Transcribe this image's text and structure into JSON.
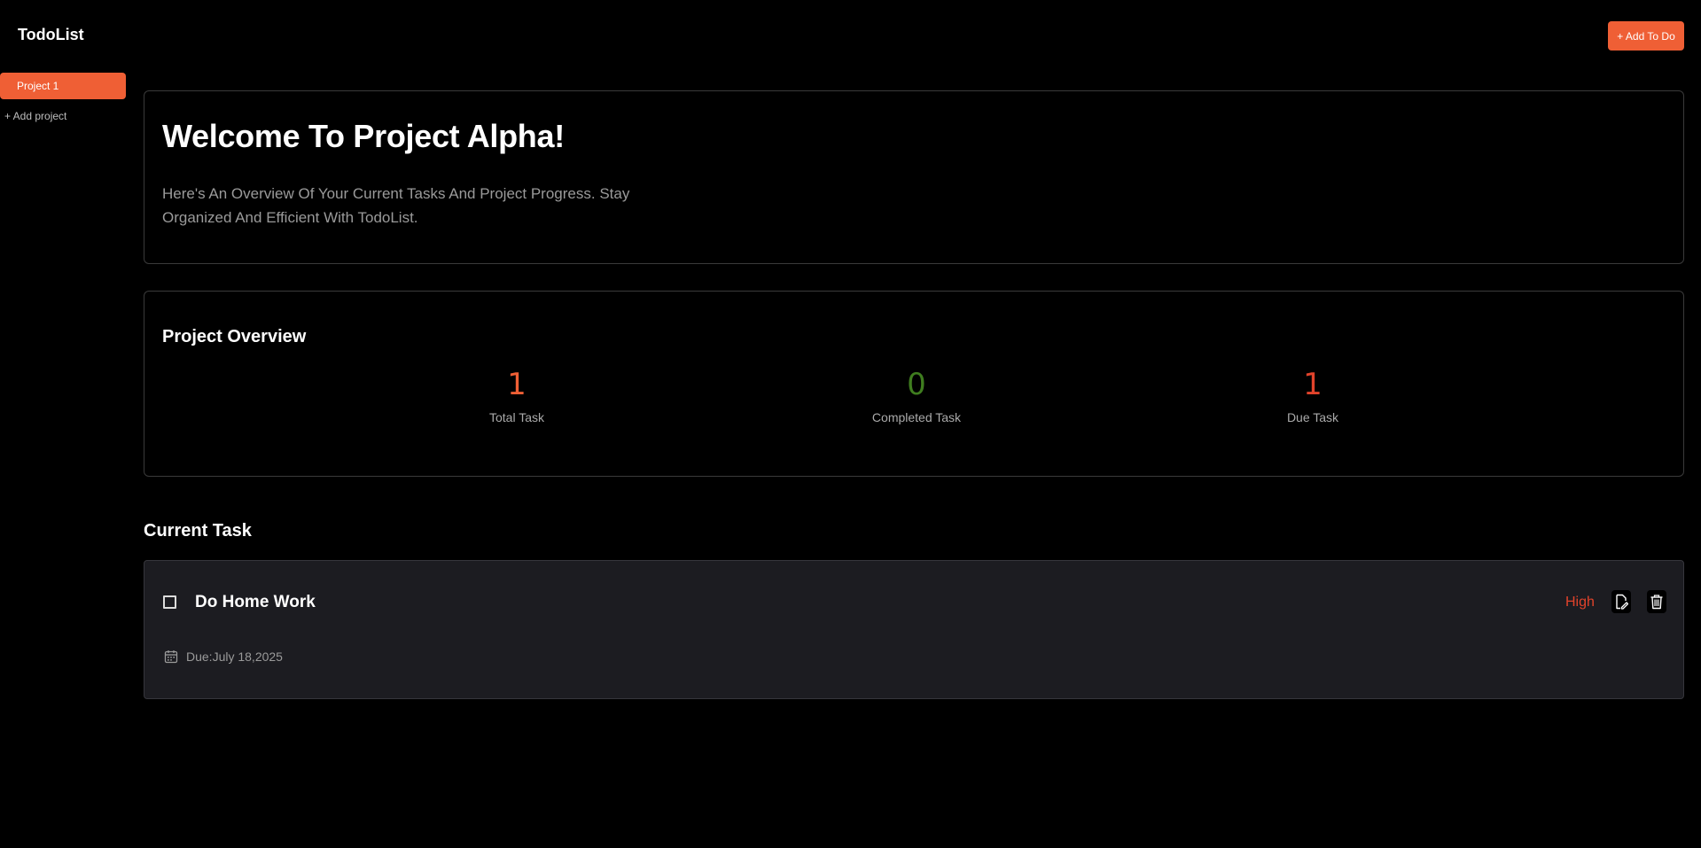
{
  "header": {
    "app_title": "TodoList",
    "add_todo_label": "+ Add To Do"
  },
  "sidebar": {
    "projects": [
      {
        "label": "Project 1",
        "active": true
      }
    ],
    "add_project_label": "+ Add project"
  },
  "welcome": {
    "title": "Welcome To Project Alpha!",
    "subtitle": "Here's An Overview Of Your Current Tasks And Project Progress. Stay Organized And Efficient With TodoList."
  },
  "overview": {
    "title": "Project Overview",
    "stats": [
      {
        "value": "1",
        "label": "Total Task",
        "color": "#ef5f35"
      },
      {
        "value": "0",
        "label": "Completed Task",
        "color": "#3f7d1f"
      },
      {
        "value": "1",
        "label": "Due Task",
        "color": "#e2432b"
      }
    ]
  },
  "current_task": {
    "heading": "Current Task",
    "tasks": [
      {
        "title": "Do Home Work",
        "priority": "High",
        "priority_color": "#e2432b",
        "due": "Due:July 18,2025",
        "completed": false,
        "icons": {
          "edit": "edit-icon",
          "delete": "trash-icon",
          "due": "calendar-icon"
        }
      }
    ]
  },
  "colors": {
    "accent": "#ef5f35",
    "background": "#000000",
    "card_border": "#3a3a3a",
    "task_card_bg": "#1c1c21"
  }
}
